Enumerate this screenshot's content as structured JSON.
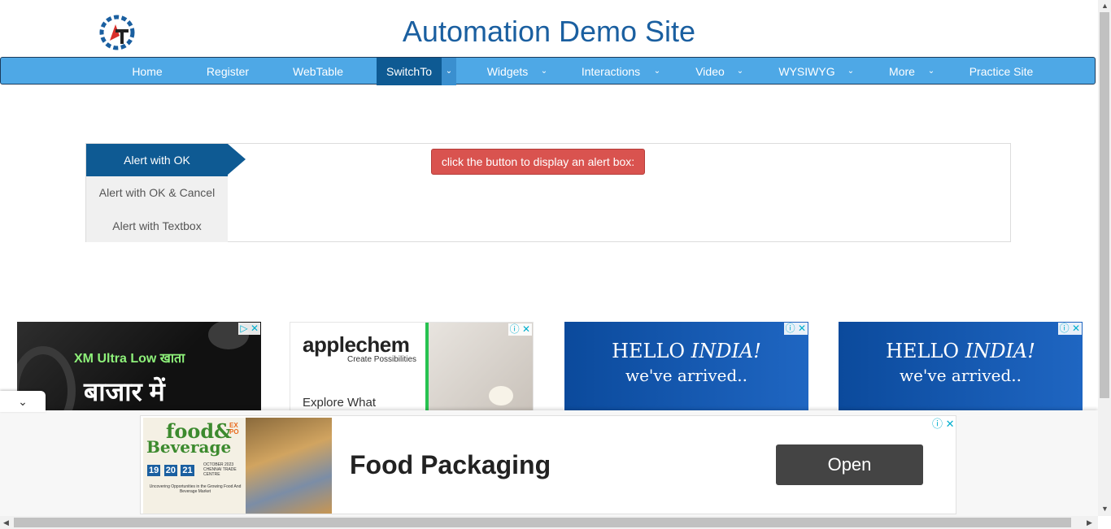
{
  "header": {
    "title": "Automation Demo Site"
  },
  "nav": {
    "items": [
      {
        "label": "Home"
      },
      {
        "label": "Register"
      },
      {
        "label": "WebTable"
      },
      {
        "label": "SwitchTo"
      },
      {
        "label": "Widgets"
      },
      {
        "label": "Interactions"
      },
      {
        "label": "Video"
      },
      {
        "label": "WYSIWYG"
      },
      {
        "label": "More"
      },
      {
        "label": "Practice Site"
      }
    ],
    "active": "SwitchTo"
  },
  "alerts": {
    "tabs": [
      {
        "label": "Alert with OK"
      },
      {
        "label": "Alert with OK & Cancel"
      },
      {
        "label": "Alert with Textbox"
      }
    ],
    "button_label": "click the button to display an alert box:"
  },
  "ads": {
    "ad1": {
      "line1": "XM Ultra Low खाता",
      "line2": "बाजार में"
    },
    "ad2": {
      "brand": "applechem",
      "tagline": "Create Possibilities",
      "cta": "Explore What"
    },
    "ad3": {
      "line1_a": "HELLO",
      "line1_b": "INDIA!",
      "line2": "we've arrived.."
    },
    "ad4": {
      "line1_a": "HELLO",
      "line1_b": "INDIA!",
      "line2": "we've arrived.."
    }
  },
  "anchor_ad": {
    "logo_line1": "food&",
    "logo_line2": "Beverage",
    "logo_expo": "EXPO",
    "dates": [
      "19",
      "20",
      "21"
    ],
    "date_caption": "OCTOBER 2023 CHENNAI TRADE CENTRE",
    "logo_caption": "Uncovering Opportunities in the Growing Food And Beverage Market",
    "headline": "Food Packaging",
    "open_label": "Open"
  },
  "colors": {
    "nav_bg": "#4ea8e6",
    "nav_active": "#0e5a93",
    "title": "#1a5fa0",
    "alert_button": "#d9534f"
  }
}
